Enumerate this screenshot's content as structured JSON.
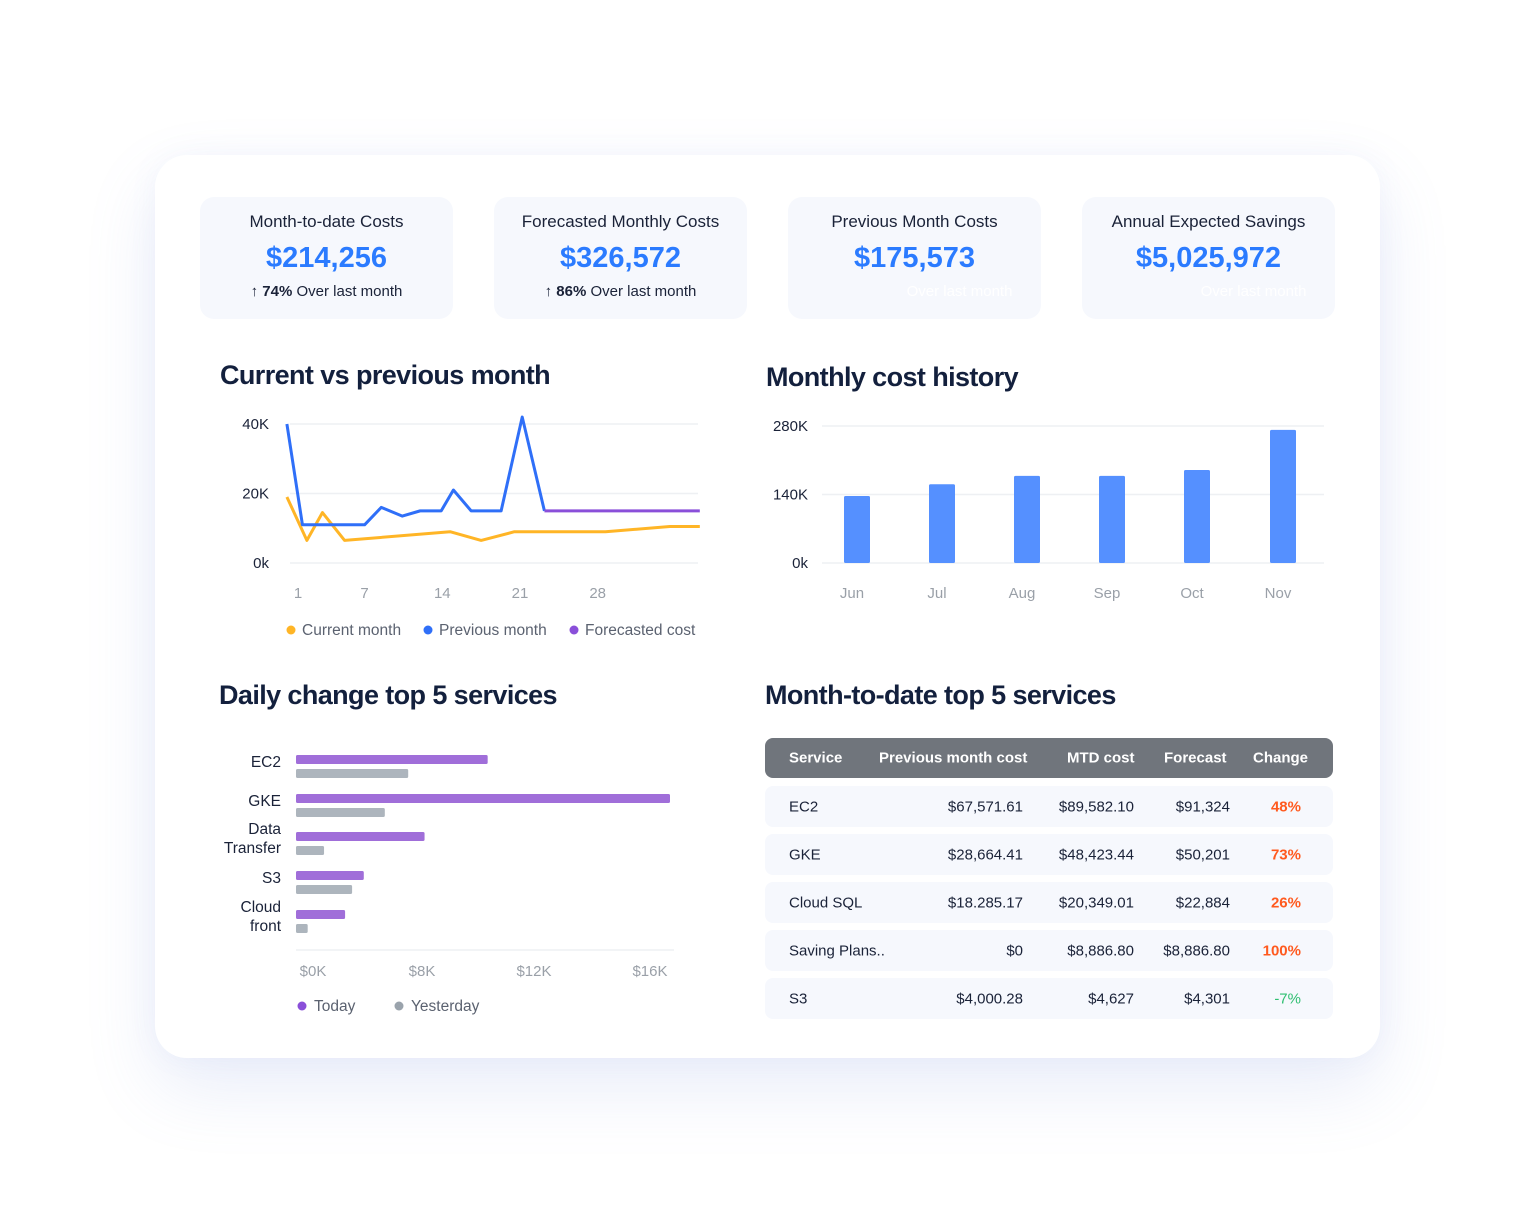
{
  "kpis": [
    {
      "title": "Month-to-date Costs",
      "value": "$214,256",
      "change": "74%",
      "change_text": "Over last month",
      "arrow": "arrow-up-icon"
    },
    {
      "title": "Forecasted Monthly Costs",
      "value": "$326,572",
      "change": "86%",
      "change_text": "Over last month",
      "arrow": "arrow-up-icon"
    },
    {
      "title": "Previous Month Costs",
      "value": "$175,573",
      "change_text": "Over last month"
    },
    {
      "title": "Annual Expected Savings",
      "value": "$5,025,972",
      "change_text": "Over last month"
    }
  ],
  "colors": {
    "accent": "#2b7bff",
    "current": "#ffb526",
    "previous": "#2f6ff8",
    "forecast": "#8a4fd9",
    "today": "#a06ed9",
    "yesterday": "#adb5bd",
    "up": "#ff5a1f",
    "down": "#2fbf71"
  },
  "sections": {
    "line": "Current vs previous month",
    "bar": "Monthly cost history",
    "hbar": "Daily change top 5 services",
    "table": "Month-to-date top 5 services"
  },
  "chart_data": [
    {
      "type": "line",
      "title": "Current vs previous month",
      "x_ticks": [
        "1",
        "7",
        "14",
        "21",
        "28"
      ],
      "y_ticks": [
        "0k",
        "20K",
        "40K"
      ],
      "ylim": [
        0,
        40000
      ],
      "grid": true,
      "legend": "bottom",
      "series": [
        {
          "name": "Current month",
          "points": [
            [
              0,
              19000
            ],
            [
              1.8,
              6500
            ],
            [
              3.2,
              14500
            ],
            [
              5.2,
              6500
            ],
            [
              14.7,
              9000
            ],
            [
              17.5,
              6500
            ],
            [
              20.5,
              9000
            ],
            [
              28.7,
              9000
            ],
            [
              34.5,
              10500
            ],
            [
              37.2,
              10500
            ]
          ]
        },
        {
          "name": "Previous month",
          "points": [
            [
              0,
              40000
            ],
            [
              1.4,
              11000
            ],
            [
              7,
              11000
            ],
            [
              8.5,
              16000
            ],
            [
              10.4,
              13500
            ],
            [
              12,
              15000
            ],
            [
              13.9,
              15000
            ],
            [
              15,
              21000
            ],
            [
              16.6,
              15000
            ],
            [
              19.3,
              15000
            ],
            [
              21.2,
              42000
            ],
            [
              23.2,
              15000
            ]
          ]
        },
        {
          "name": "Forecasted cost",
          "points": [
            [
              23.2,
              15000
            ],
            [
              37.2,
              15000
            ]
          ]
        }
      ]
    },
    {
      "type": "bar",
      "title": "Monthly cost history",
      "categories": [
        "Jun",
        "Jul",
        "Aug",
        "Sep",
        "Oct",
        "Nov"
      ],
      "values": [
        137000,
        161000,
        178000,
        178000,
        190000,
        272000
      ],
      "y_ticks": [
        "0k",
        "140K",
        "280K"
      ],
      "ylim": [
        0,
        280000
      ],
      "grid": true
    },
    {
      "type": "bar",
      "orientation": "horizontal",
      "title": "Daily change top 5 services",
      "categories": [
        "EC2",
        "GKE",
        "Data Transfer",
        "S3",
        "Cloud front"
      ],
      "category_lines": [
        [
          "EC2"
        ],
        [
          "GKE"
        ],
        [
          "Data",
          "Transfer"
        ],
        [
          "S3"
        ],
        [
          "Cloud",
          "front"
        ]
      ],
      "x_ticks": [
        "$0K",
        "$8K",
        "$12K",
        "$16K"
      ],
      "xlim": [
        0,
        16000
      ],
      "legend": "bottom",
      "series": [
        {
          "name": "Today",
          "values": [
            8200,
            16000,
            5500,
            2900,
            2100
          ]
        },
        {
          "name": "Yesterday",
          "values": [
            4800,
            3800,
            1200,
            2400,
            500
          ]
        }
      ]
    }
  ],
  "table": {
    "headers": [
      "Service",
      "Previous month cost",
      "MTD cost",
      "Forecast",
      "Change"
    ],
    "rows": [
      {
        "service": "EC2",
        "prev": "$67,571.61",
        "mtd": "$89,582.10",
        "forecast": "$91,324",
        "change": "48%",
        "dir": "up"
      },
      {
        "service": "GKE",
        "prev": "$28,664.41",
        "mtd": "$48,423.44",
        "forecast": "$50,201",
        "change": "73%",
        "dir": "up"
      },
      {
        "service": "Cloud SQL",
        "prev": "$18.285.17",
        "mtd": "$20,349.01",
        "forecast": "$22,884",
        "change": "26%",
        "dir": "up"
      },
      {
        "service": "Saving Plans..",
        "prev": "$0",
        "mtd": "$8,886.80",
        "forecast": "$8,886.80",
        "change": "100%",
        "dir": "up"
      },
      {
        "service": "S3",
        "prev": "$4,000.28",
        "mtd": "$4,627",
        "forecast": "$4,301",
        "change": "-7%",
        "dir": "down"
      }
    ]
  }
}
